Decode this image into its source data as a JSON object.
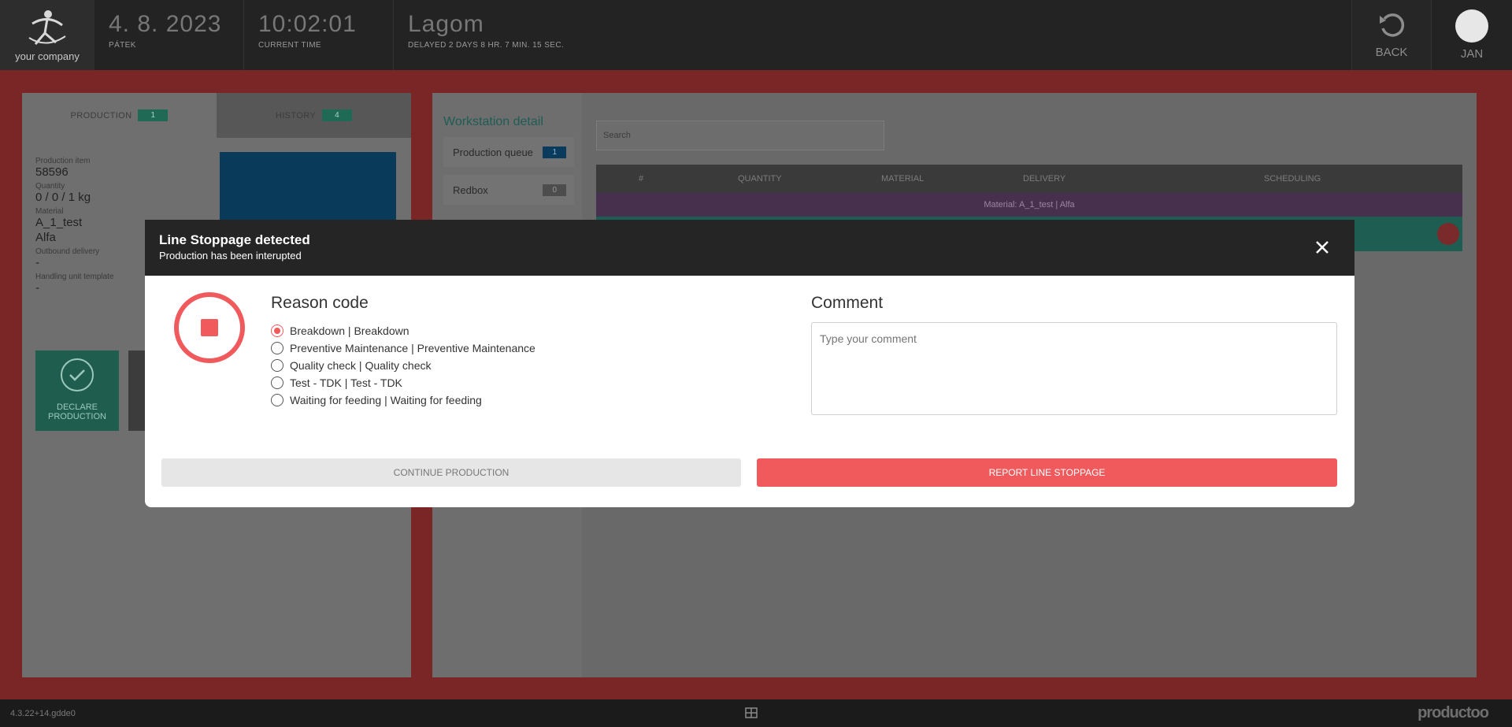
{
  "header": {
    "logo_text": "your company",
    "date": "4. 8. 2023",
    "weekday": "PÁTEK",
    "time": "10:02:01",
    "time_label": "CURRENT TIME",
    "line_name": "Lagom",
    "delay_text": "DELAYED 2 DAYS 8 HR. 7 MIN. 15 SEC.",
    "back_label": "BACK",
    "user_name": "JAN"
  },
  "left_panel": {
    "tabs": [
      {
        "label": "PRODUCTION",
        "count": "1"
      },
      {
        "label": "HISTORY",
        "count": "4"
      }
    ],
    "fields": [
      {
        "label": "Production item",
        "value": "58596"
      },
      {
        "label": "Quantity",
        "value": "0 / 0 / 1 kg"
      },
      {
        "label": "Material",
        "value": "A_1_test"
      },
      {
        "label": "",
        "value": "Alfa"
      },
      {
        "label": "Outbound delivery",
        "value": "-"
      },
      {
        "label": "Handling unit template",
        "value": "-"
      }
    ],
    "declare_label": "DECLARE PRODUCTION"
  },
  "workstation": {
    "title": "Workstation detail",
    "items": [
      {
        "label": "Production queue",
        "count": "1"
      },
      {
        "label": "Redbox",
        "count": "0"
      }
    ],
    "search_placeholder": "Search",
    "columns": [
      "#",
      "QUANTITY",
      "MATERIAL",
      "DELIVERY",
      "SCHEDULING"
    ],
    "group_label": "Material: A_1_test | Alfa"
  },
  "modal": {
    "title": "Line Stoppage detected",
    "subtitle": "Production has been interupted",
    "reason_title": "Reason code",
    "reasons": [
      "Breakdown | Breakdown",
      "Preventive Maintenance | Preventive Maintenance",
      "Quality check | Quality check",
      "Test - TDK | Test - TDK",
      "Waiting for feeding | Waiting for feeding"
    ],
    "selected_reason": 0,
    "comment_title": "Comment",
    "comment_placeholder": "Type your comment",
    "continue_label": "CONTINUE PRODUCTION",
    "report_label": "REPORT LINE STOPPAGE"
  },
  "footer": {
    "version": "4.3.22+14.gdde0",
    "brand": "productoo"
  },
  "colors": {
    "accent_red": "#f05a5c",
    "teal": "#1f5e4f",
    "header_bg": "#232323"
  }
}
